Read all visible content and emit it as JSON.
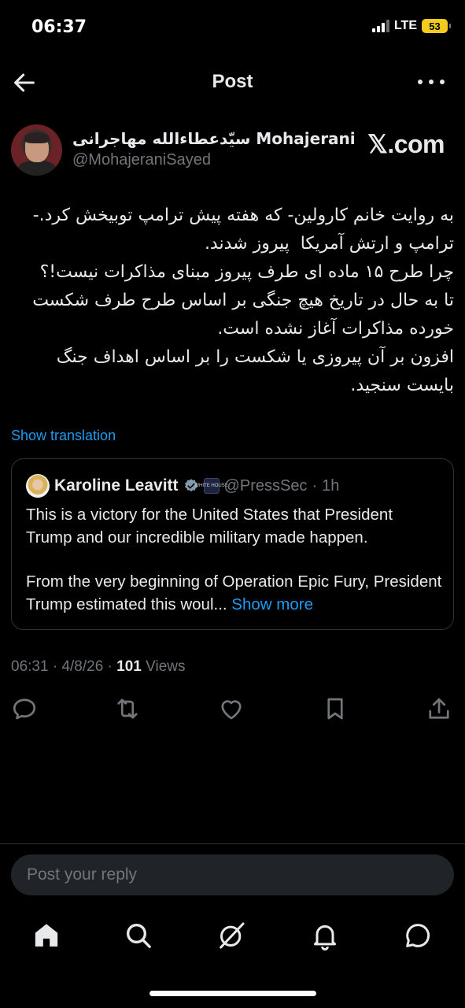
{
  "status_bar": {
    "time": "06:37",
    "network": "LTE",
    "battery": "53"
  },
  "header": {
    "title": "Post",
    "back_icon": "arrow-left-icon",
    "more_icon": "more-horizontal-icon"
  },
  "author": {
    "name": "سیّدعطاءالله مهاجرانی Mohajerani",
    "handle": "@MohajeraniSayed",
    "source_brand": "𝕏.com"
  },
  "tweet": {
    "lines": [
      "به روایت خانم کارولین- که هفته پیش ترامپ توبیخش کرد.- ترامپ و ارتش آمریکا  پیروز شدند.",
      "چرا طرح ۱۵ ماده ای طرف پیروز مبنای مذاکرات نیست!؟",
      "تا به حال در تاریخ هیچ جنگی بر اساس طرح طرف شکست خورده مذاکرات آغاز نشده است.",
      "افزون بر آن پیروزی یا شکست را بر اساس اهداف جنگ بایست سنجید."
    ],
    "show_translation": "Show translation"
  },
  "quote": {
    "name": "Karoline Leavitt",
    "gov_badge": "WHITE HOUSE",
    "handle": "@PressSec",
    "time": "1h",
    "separator": "·",
    "paragraph1": "This is a victory for the United States that President Trump and our incredible military made happen.",
    "paragraph2": "From the very beginning of Operation Epic Fury, President Trump estimated this woul...",
    "show_more": "Show more"
  },
  "meta": {
    "time": "06:31",
    "date": "4/8/26",
    "views_count": "101",
    "views_label": "Views",
    "separator": "·"
  },
  "actions": [
    "reply-icon",
    "retweet-icon",
    "like-icon",
    "bookmark-icon",
    "share-icon"
  ],
  "reply": {
    "placeholder": "Post your reply"
  },
  "bottom_nav": [
    "home-icon",
    "search-icon",
    "grok-icon",
    "notifications-icon",
    "messages-icon"
  ],
  "colors": {
    "background": "#000000",
    "accent": "#1d9bf0",
    "text": "#e7e9ea",
    "muted": "#71767b",
    "border": "#2f3336"
  }
}
